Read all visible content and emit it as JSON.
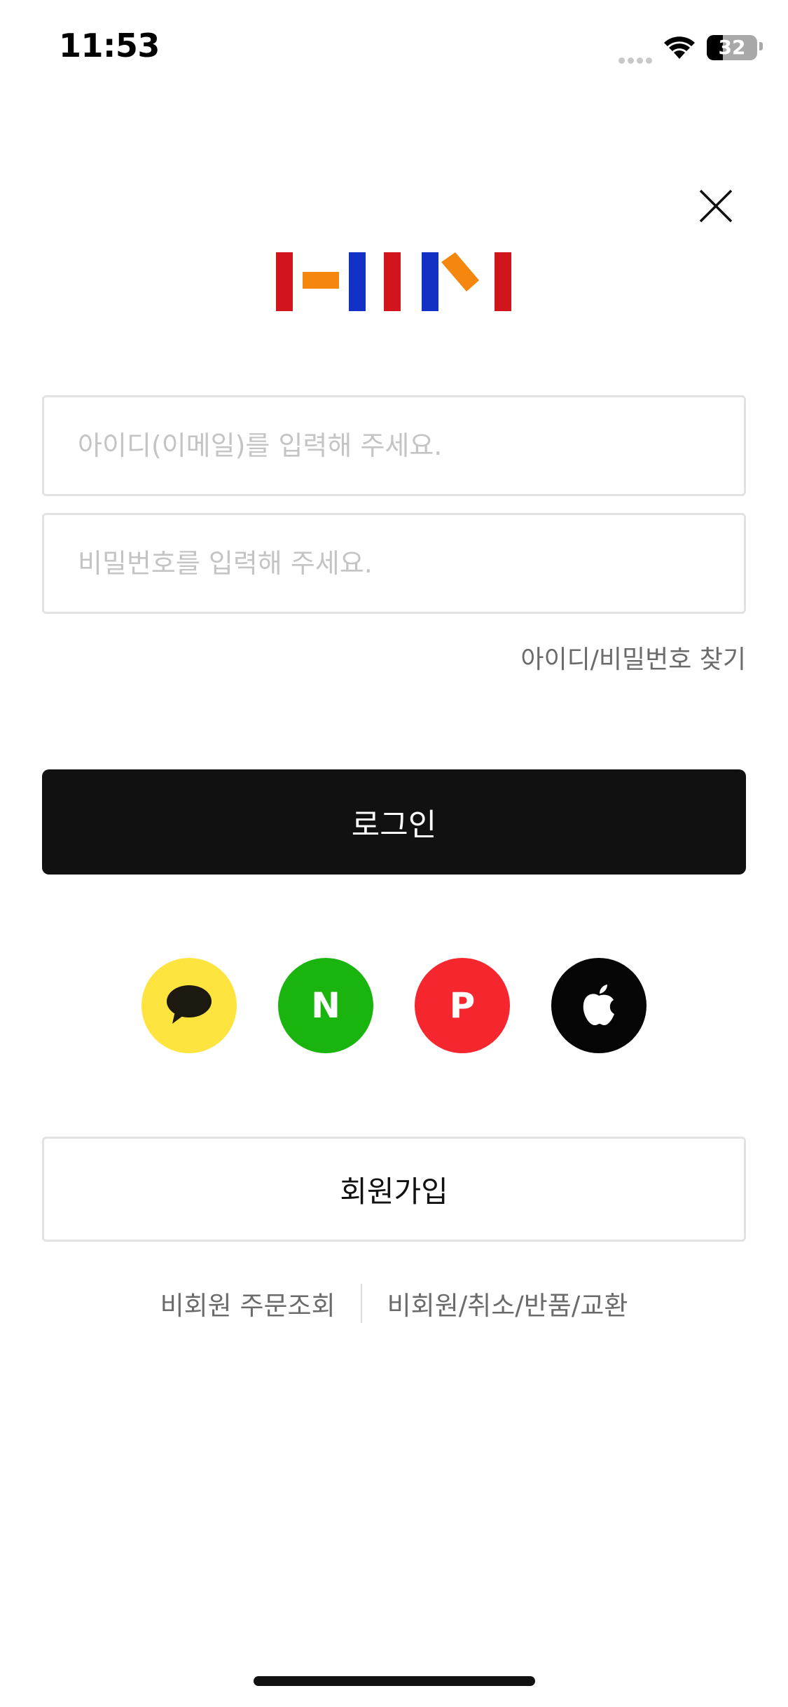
{
  "status_bar": {
    "time": "11:53",
    "battery": "32"
  },
  "close": {
    "icon": "close-icon"
  },
  "logo": {
    "icon": "brand-logo",
    "colors": {
      "red": "#d0161c",
      "orange": "#f5870f",
      "blue": "#1431c6"
    }
  },
  "login_form": {
    "id_placeholder": "아이디(이메일)를 입력해 주세요.",
    "id_value": "",
    "password_placeholder": "비밀번호를 입력해 주세요.",
    "password_value": "",
    "find_link": "아이디/비밀번호 찾기",
    "login_button": "로그인"
  },
  "social_login": [
    {
      "name": "kakao",
      "icon": "kakao-speech-bubble-icon",
      "color": "#fee43f"
    },
    {
      "name": "naver",
      "icon": "naver-n-icon",
      "label": "N",
      "color": "#19b50e"
    },
    {
      "name": "payco",
      "icon": "payco-p-icon",
      "label": "P",
      "color": "#f5262e"
    },
    {
      "name": "apple",
      "icon": "apple-icon",
      "color": "#050505"
    }
  ],
  "signup_button": "회원가입",
  "footer": {
    "guest_order": "비회원 주문조회",
    "guest_cancel": "비회원/취소/반품/교환"
  }
}
